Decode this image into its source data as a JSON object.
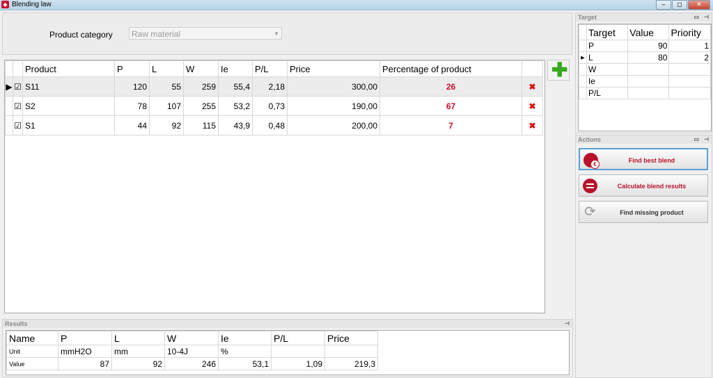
{
  "window": {
    "title": "Blending law",
    "minimize": "–",
    "restore": "◻",
    "close": "✕"
  },
  "category": {
    "label": "Product category",
    "value": "Raw material"
  },
  "products": {
    "headers": [
      "Product",
      "P",
      "L",
      "W",
      "Ie",
      "P/L",
      "Price",
      "Percentage of product"
    ],
    "rows": [
      {
        "selected": true,
        "checked": true,
        "name": "S11",
        "P": "120",
        "L": "55",
        "W": "259",
        "Ie": "55,4",
        "PL": "2,18",
        "price": "300,00",
        "pct": "26"
      },
      {
        "selected": false,
        "checked": true,
        "name": "S2",
        "P": "78",
        "L": "107",
        "W": "255",
        "Ie": "53,2",
        "PL": "0,73",
        "price": "190,00",
        "pct": "67"
      },
      {
        "selected": false,
        "checked": true,
        "name": "S1",
        "P": "44",
        "L": "92",
        "W": "115",
        "Ie": "43,9",
        "PL": "0,48",
        "price": "200,00",
        "pct": "7"
      }
    ]
  },
  "results": {
    "title": "Results",
    "row_labels": {
      "name": "Name",
      "unit": "Unit",
      "value": "Value"
    },
    "cols": [
      {
        "name": "P",
        "unit": "mmH2O",
        "value": "87"
      },
      {
        "name": "L",
        "unit": "mm",
        "value": "92"
      },
      {
        "name": "W",
        "unit": "10-4J",
        "value": "246"
      },
      {
        "name": "Ie",
        "unit": "%",
        "value": "53,1"
      },
      {
        "name": "P/L",
        "unit": "",
        "value": "1,09"
      },
      {
        "name": "Price",
        "unit": "",
        "value": "219,3"
      }
    ]
  },
  "target": {
    "title": "Target",
    "headers": [
      "Target",
      "Value",
      "Priority"
    ],
    "rows": [
      {
        "name": "P",
        "value": "90",
        "priority": "1"
      },
      {
        "name": "L",
        "value": "80",
        "priority": "2"
      },
      {
        "name": "W",
        "value": "",
        "priority": ""
      },
      {
        "name": "Ie",
        "value": "",
        "priority": ""
      },
      {
        "name": "P/L",
        "value": "",
        "priority": ""
      }
    ]
  },
  "actions": {
    "title": "Actions",
    "find_best": "Find best blend",
    "calculate": "Calculate blend results",
    "find_missing": "Find missing product"
  },
  "colors": {
    "accent_red": "#c8102e",
    "add_green": "#38a81e"
  }
}
